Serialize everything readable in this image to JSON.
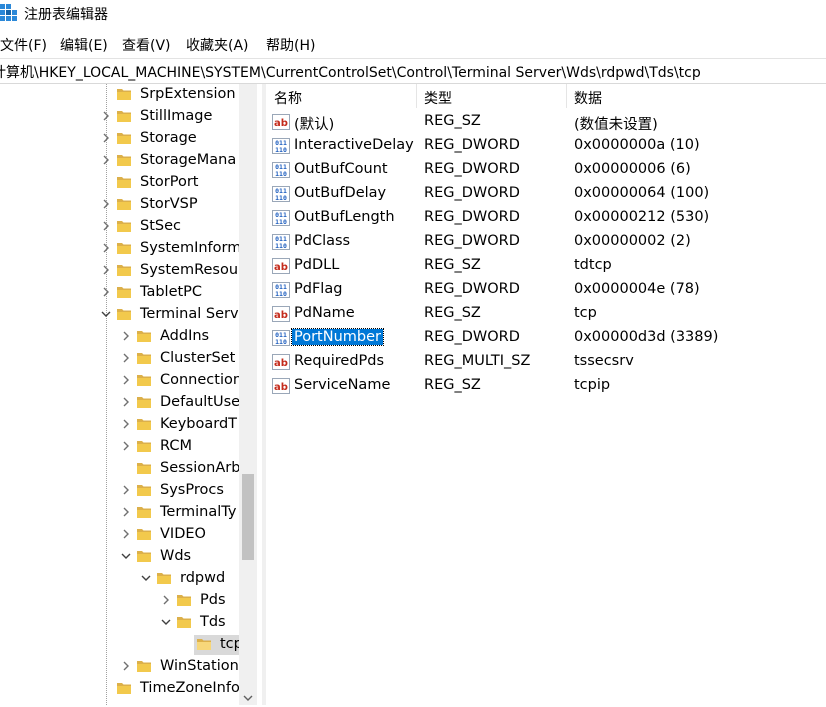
{
  "window": {
    "title": "注册表编辑器"
  },
  "menu": [
    {
      "label": "文件(F)"
    },
    {
      "label": "编辑(E)"
    },
    {
      "label": "查看(V)"
    },
    {
      "label": "收藏夹(A)"
    },
    {
      "label": "帮助(H)"
    }
  ],
  "address": {
    "path": "计算机\\HKEY_LOCAL_MACHINE\\SYSTEM\\CurrentControlSet\\Control\\Terminal Server\\Wds\\rdpwd\\Tds\\tcp"
  },
  "tree": {
    "items": [
      {
        "label": "SrpExtension",
        "level": 0,
        "expander": "none"
      },
      {
        "label": "StillImage",
        "level": 0,
        "expander": "collapsed"
      },
      {
        "label": "Storage",
        "level": 0,
        "expander": "collapsed"
      },
      {
        "label": "StorageMana",
        "level": 0,
        "expander": "collapsed"
      },
      {
        "label": "StorPort",
        "level": 0,
        "expander": "none"
      },
      {
        "label": "StorVSP",
        "level": 0,
        "expander": "collapsed"
      },
      {
        "label": "StSec",
        "level": 0,
        "expander": "collapsed"
      },
      {
        "label": "SystemInform",
        "level": 0,
        "expander": "collapsed"
      },
      {
        "label": "SystemResou",
        "level": 0,
        "expander": "collapsed"
      },
      {
        "label": "TabletPC",
        "level": 0,
        "expander": "collapsed"
      },
      {
        "label": "Terminal Serv",
        "level": 0,
        "expander": "expanded"
      },
      {
        "label": "AddIns",
        "level": 1,
        "expander": "collapsed"
      },
      {
        "label": "ClusterSet",
        "level": 1,
        "expander": "collapsed"
      },
      {
        "label": "Connection",
        "level": 1,
        "expander": "collapsed"
      },
      {
        "label": "DefaultUse",
        "level": 1,
        "expander": "collapsed"
      },
      {
        "label": "KeyboardT",
        "level": 1,
        "expander": "collapsed"
      },
      {
        "label": "RCM",
        "level": 1,
        "expander": "collapsed"
      },
      {
        "label": "SessionArb",
        "level": 1,
        "expander": "none"
      },
      {
        "label": "SysProcs",
        "level": 1,
        "expander": "collapsed"
      },
      {
        "label": "TerminalTy",
        "level": 1,
        "expander": "collapsed"
      },
      {
        "label": "VIDEO",
        "level": 1,
        "expander": "collapsed"
      },
      {
        "label": "Wds",
        "level": 1,
        "expander": "expanded"
      },
      {
        "label": "rdpwd",
        "level": 2,
        "expander": "expanded"
      },
      {
        "label": "Pds",
        "level": 3,
        "expander": "collapsed"
      },
      {
        "label": "Tds",
        "level": 3,
        "expander": "expanded"
      },
      {
        "label": "tcp",
        "level": 4,
        "expander": "none",
        "selected": true
      },
      {
        "label": "WinStation",
        "level": 1,
        "expander": "collapsed"
      },
      {
        "label": "TimeZoneInfo",
        "level": 0,
        "expander": "none"
      }
    ]
  },
  "list": {
    "columns": [
      "名称",
      "类型",
      "数据"
    ],
    "rows": [
      {
        "name": "(默认)",
        "type": "REG_SZ",
        "data": "(数值未设置)",
        "icon": "string-value-icon"
      },
      {
        "name": "InteractiveDelay",
        "type": "REG_DWORD",
        "data": "0x0000000a (10)",
        "icon": "binary-value-icon"
      },
      {
        "name": "OutBufCount",
        "type": "REG_DWORD",
        "data": "0x00000006 (6)",
        "icon": "binary-value-icon"
      },
      {
        "name": "OutBufDelay",
        "type": "REG_DWORD",
        "data": "0x00000064 (100)",
        "icon": "binary-value-icon"
      },
      {
        "name": "OutBufLength",
        "type": "REG_DWORD",
        "data": "0x00000212 (530)",
        "icon": "binary-value-icon"
      },
      {
        "name": "PdClass",
        "type": "REG_DWORD",
        "data": "0x00000002 (2)",
        "icon": "binary-value-icon"
      },
      {
        "name": "PdDLL",
        "type": "REG_SZ",
        "data": "tdtcp",
        "icon": "string-value-icon"
      },
      {
        "name": "PdFlag",
        "type": "REG_DWORD",
        "data": "0x0000004e (78)",
        "icon": "binary-value-icon"
      },
      {
        "name": "PdName",
        "type": "REG_SZ",
        "data": "tcp",
        "icon": "string-value-icon"
      },
      {
        "name": "PortNumber",
        "type": "REG_DWORD",
        "data": "0x00000d3d (3389)",
        "icon": "binary-value-icon",
        "selected": true
      },
      {
        "name": "RequiredPds",
        "type": "REG_MULTI_SZ",
        "data": "tssecsrv",
        "icon": "string-value-icon"
      },
      {
        "name": "ServiceName",
        "type": "REG_SZ",
        "data": "tcpip",
        "icon": "string-value-icon"
      }
    ]
  },
  "colors": {
    "selection": "#0078d7",
    "folder": "#f0c040",
    "tree_selected": "#d9d9d9"
  }
}
